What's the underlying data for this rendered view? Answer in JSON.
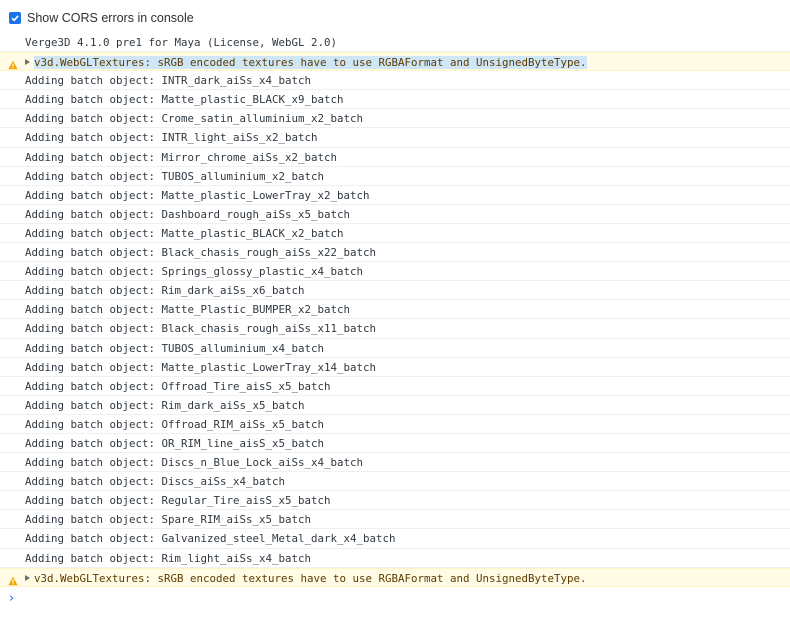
{
  "toolbar": {
    "cors_checkbox_label": "Show CORS errors in console",
    "cors_checked": true
  },
  "console": {
    "info_line": "Verge3D 4.1.0 pre1 for Maya (License, WebGL 2.0)",
    "warning_text": "v3d.WebGLTextures: sRGB encoded textures have to use RGBAFormat and UnsignedByteType.",
    "batch_prefix": "Adding batch object:",
    "batch_objects": [
      "INTR_dark_aiSs_x4_batch",
      "Matte_plastic_BLACK_x9_batch",
      "Crome_satin_alluminium_x2_batch",
      "INTR_light_aiSs_x2_batch",
      "Mirror_chrome_aiSs_x2_batch",
      "TUBOS_alluminium_x2_batch",
      "Matte_plastic_LowerTray_x2_batch",
      "Dashboard_rough_aiSs_x5_batch",
      "Matte_plastic_BLACK_x2_batch",
      "Black_chasis_rough_aiSs_x22_batch",
      "Springs_glossy_plastic_x4_batch",
      "Rim_dark_aiSs_x6_batch",
      "Matte_Plastic_BUMPER_x2_batch",
      "Black_chasis_rough_aiSs_x11_batch",
      "TUBOS_alluminium_x4_batch",
      "Matte_plastic_LowerTray_x14_batch",
      "Offroad_Tire_aisS_x5_batch",
      "Rim_dark_aiSs_x5_batch",
      "Offroad_RIM_aiSs_x5_batch",
      "OR_RIM_line_aisS_x5_batch",
      "Discs_n_Blue_Lock_aiSs_x4_batch",
      "Discs_aiSs_x4_batch",
      "Regular_Tire_aisS_x5_batch",
      "Spare_RIM_aiSs_x5_batch",
      "Galvanized_steel_Metal_dark_x4_batch",
      "Rim_light_aiSs_x4_batch"
    ],
    "prompt_symbol": "›"
  },
  "colors": {
    "accent": "#1a73e8",
    "warning_bg": "#fffbe5",
    "warning_text": "#5c3c00",
    "highlight": "#cfe6f7"
  },
  "icons": {
    "warning": "warning-icon",
    "expand": "expand-triangle-icon",
    "prompt": "prompt-chevron-icon"
  }
}
